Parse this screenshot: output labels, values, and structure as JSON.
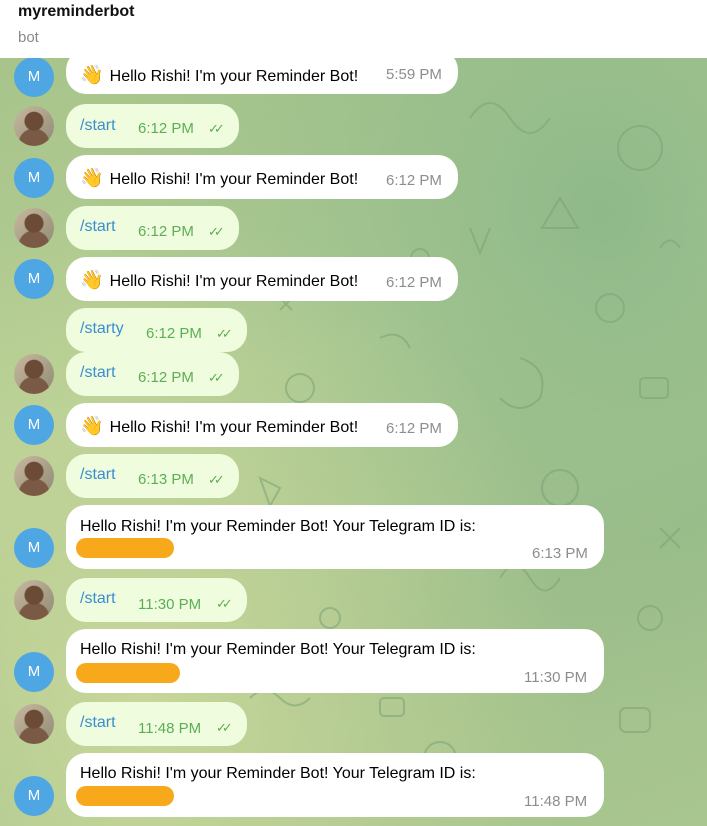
{
  "header": {
    "title": "myreminderbot",
    "subtitle": "bot"
  },
  "avatars": {
    "bot_letter": "M"
  },
  "messages": [
    {
      "text": "Hello Rishi! I'm your Reminder Bot!",
      "time": "5:59 PM"
    },
    {
      "text": "/start",
      "time": "6:12 PM"
    },
    {
      "text": "Hello Rishi! I'm your Reminder Bot!",
      "time": "6:12 PM"
    },
    {
      "text": "/start",
      "time": "6:12 PM"
    },
    {
      "text": "Hello Rishi! I'm your Reminder Bot!",
      "time": "6:12 PM"
    },
    {
      "text": "/starty",
      "time": "6:12 PM"
    },
    {
      "text": "/start",
      "time": "6:12 PM"
    },
    {
      "text": "Hello Rishi! I'm your Reminder Bot!",
      "time": "6:12 PM"
    },
    {
      "text": "/start",
      "time": "6:13 PM"
    },
    {
      "text": "Hello Rishi! I'm your Reminder Bot! Your Telegram ID is:",
      "time": "6:13 PM"
    },
    {
      "text": "/start",
      "time": "11:30 PM"
    },
    {
      "text": "Hello Rishi! I'm your Reminder Bot! Your Telegram ID is:",
      "time": "11:30 PM"
    },
    {
      "text": "/start",
      "time": "11:48 PM"
    },
    {
      "text": "Hello Rishi! I'm your Reminder Bot! Your Telegram ID is:",
      "time": "11:48 PM"
    }
  ],
  "icons": {
    "wave": "waving-hand-emoji",
    "read_receipt": "double-check-icon"
  },
  "colors": {
    "incoming_bubble": "#ffffff",
    "outgoing_bubble": "#effdde",
    "command_text": "#3a8ed0",
    "read_check": "#5cae55",
    "bot_avatar": "#4ea6e2",
    "redaction": "#f7a81b"
  }
}
